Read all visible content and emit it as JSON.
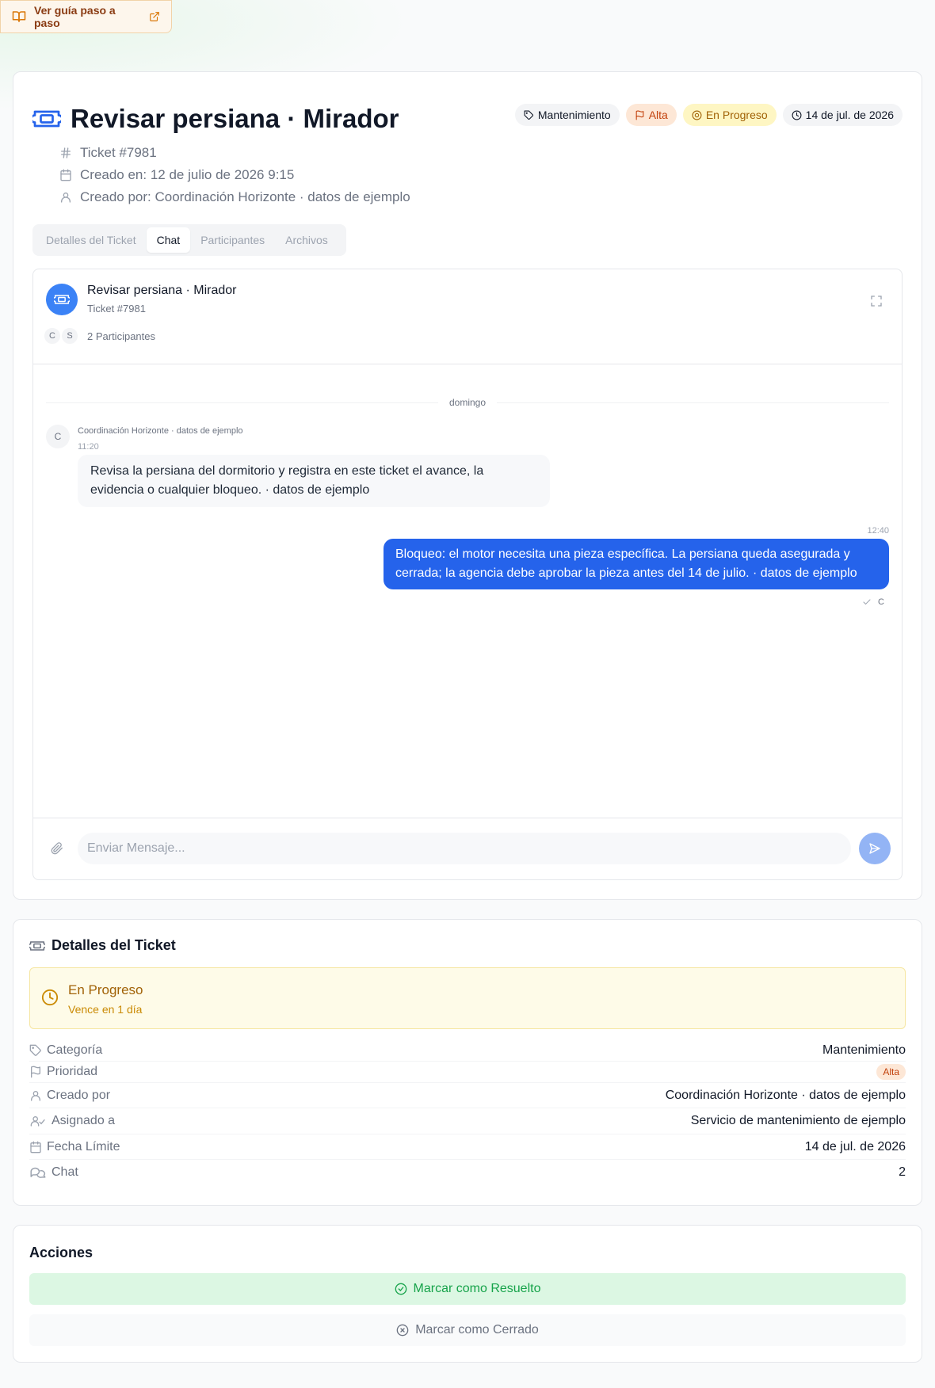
{
  "guide": {
    "label": "Ver guía paso a paso"
  },
  "ticket": {
    "title": "Revisar persiana · Mirador",
    "number": "Ticket #7981",
    "created_at": "Creado en: 12 de julio de 2026 9:15",
    "created_by": "Creado por: Coordinación Horizonte · datos de ejemplo"
  },
  "badges": {
    "category": "Mantenimiento",
    "priority": "Alta",
    "status": "En Progreso",
    "due_date": "14 de jul. de 2026"
  },
  "tabs": [
    {
      "label": "Detalles del Ticket",
      "active": false
    },
    {
      "label": "Chat",
      "active": true
    },
    {
      "label": "Participantes",
      "active": false
    },
    {
      "label": "Archivos",
      "active": false
    }
  ],
  "chat": {
    "title": "Revisar persiana · Mirador",
    "subtitle": "Ticket #7981",
    "participant_initials": [
      "C",
      "S"
    ],
    "participant_count": "2 Participantes",
    "day_label": "domingo",
    "messages": [
      {
        "initial": "C",
        "author": "Coordinación Horizonte · datos de ejemplo",
        "time": "11:20",
        "text": "Revisa la persiana del dormitorio y registra en este ticket el avance, la evidencia o cualquier bloqueo. · datos de ejemplo"
      },
      {
        "time": "12:40",
        "text": "Bloqueo: el motor necesita una pieza específica. La persiana queda asegurada y cerrada; la agencia debe aprobar la pieza antes del 14 de julio. · datos de ejemplo",
        "read_initial": "C"
      }
    ],
    "input_placeholder": "Enviar Mensaje..."
  },
  "details": {
    "title": "Detalles del Ticket",
    "status_name": "En Progreso",
    "status_due": "Vence en 1 día",
    "rows": [
      {
        "label": "Categoría",
        "value": "Mantenimiento",
        "icon": "tag-icon"
      },
      {
        "label": "Prioridad",
        "value": "Alta",
        "icon": "flag-icon"
      },
      {
        "label": "Creado por",
        "value": "Coordinación Horizonte · datos de ejemplo",
        "icon": "user-icon"
      },
      {
        "label": "Asignado a",
        "value": "Servicio de mantenimiento de ejemplo",
        "icon": "user-check-icon"
      },
      {
        "label": "Fecha Límite",
        "value": "14 de jul. de 2026",
        "icon": "calendar-icon"
      },
      {
        "label": "Chat",
        "value": "2",
        "icon": "chat-icon"
      }
    ]
  },
  "actions": {
    "title": "Acciones",
    "resolve_label": "Marcar como Resuelto",
    "close_label": "Marcar como Cerrado"
  },
  "colors": {
    "accent_blue": "#2563eb",
    "status_yellow": "#a16207",
    "priority_orange": "#c2410c",
    "success_green": "#16a34a"
  }
}
